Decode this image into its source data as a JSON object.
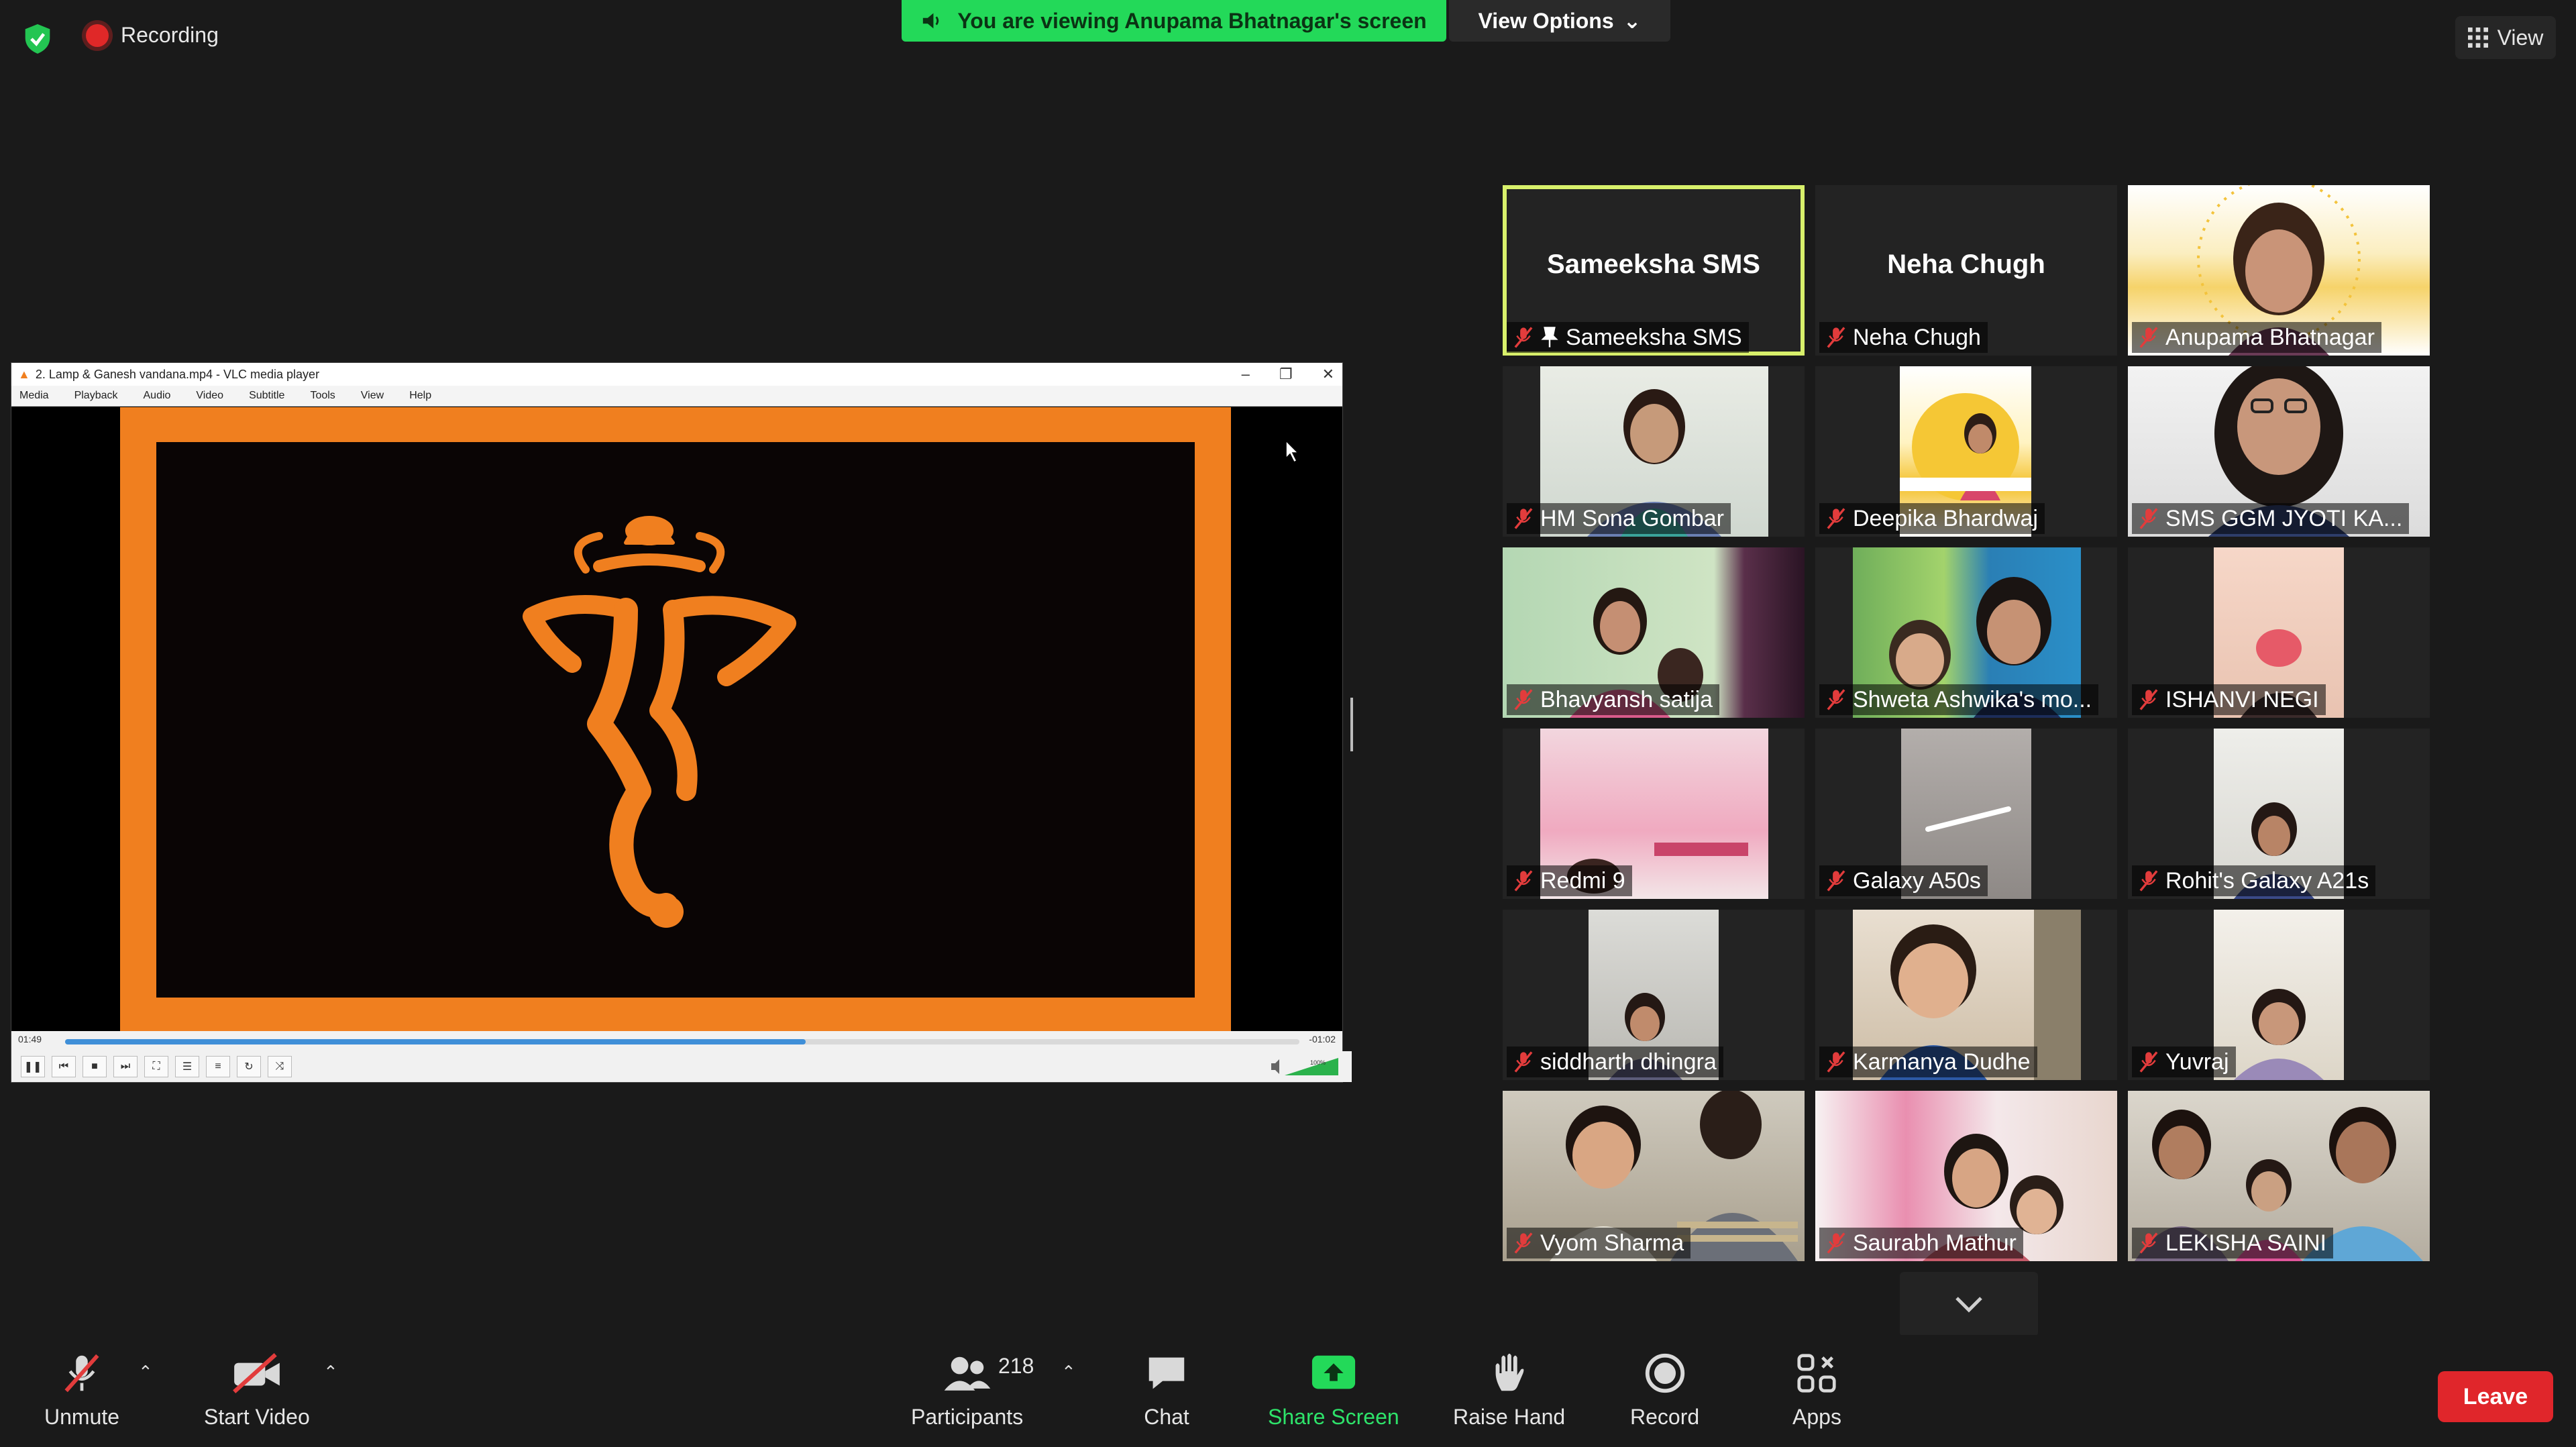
{
  "top_bar": {
    "recording_label": "Recording",
    "share_banner": "You are viewing Anupama Bhatnagar's screen",
    "view_options_label": "View Options",
    "view_label": "View"
  },
  "vlc": {
    "window_title": "2. Lamp & Ganesh vandana.mp4 - VLC media player",
    "menu": [
      "Media",
      "Playback",
      "Audio",
      "Video",
      "Subtitle",
      "Tools",
      "View",
      "Help"
    ],
    "elapsed": "01:49",
    "remaining": "-01:02",
    "progress_fraction": 0.6,
    "volume_label": "100%"
  },
  "gallery": {
    "tiles": [
      {
        "name": "Sameeksha SMS",
        "display": "Sameeksha SMS",
        "active": true,
        "pinned": true,
        "video": false
      },
      {
        "name": "Neha Chugh",
        "display": "Neha Chugh",
        "active": false,
        "video": false
      },
      {
        "name": "Anupama Bhatnagar",
        "active": false,
        "video": true
      },
      {
        "name": "HM Sona Gombar",
        "active": false,
        "video": true
      },
      {
        "name": "Deepika Bhardwaj",
        "active": false,
        "video": true
      },
      {
        "name": "SMS  GGM  JYOTI KA...",
        "active": false,
        "video": true
      },
      {
        "name": "Bhavyansh satija",
        "active": false,
        "video": true
      },
      {
        "name": "Shweta Ashwika's mo...",
        "active": false,
        "video": true
      },
      {
        "name": "ISHANVI NEGI",
        "active": false,
        "video": true
      },
      {
        "name": "Redmi 9",
        "active": false,
        "video": true
      },
      {
        "name": "Galaxy A50s",
        "active": false,
        "video": true
      },
      {
        "name": "Rohit's Galaxy A21s",
        "active": false,
        "video": true
      },
      {
        "name": "siddharth dhingra",
        "active": false,
        "video": true
      },
      {
        "name": "Karmanya Dudhe",
        "active": false,
        "video": true
      },
      {
        "name": "Yuvraj",
        "active": false,
        "video": true
      },
      {
        "name": "Vyom Sharma",
        "active": false,
        "video": true
      },
      {
        "name": "Saurabh Mathur",
        "active": false,
        "video": true
      },
      {
        "name": "LEKISHA SAINI",
        "active": false,
        "video": true
      }
    ]
  },
  "toolbar": {
    "unmute_label": "Unmute",
    "start_video_label": "Start Video",
    "participants_label": "Participants",
    "participants_count": "218",
    "chat_label": "Chat",
    "share_screen_label": "Share Screen",
    "raise_hand_label": "Raise Hand",
    "record_label": "Record",
    "apps_label": "Apps",
    "leave_label": "Leave"
  },
  "colors": {
    "share_green": "#23d959",
    "active_speaker": "#d8f06b",
    "leave_red": "#e0262b",
    "vlc_frame_orange": "#f07f1f"
  }
}
